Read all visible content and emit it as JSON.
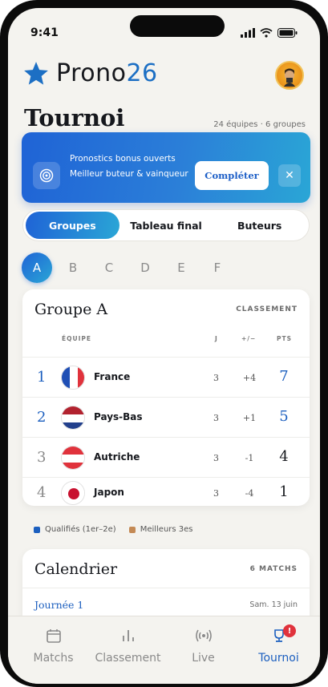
{
  "status": {
    "time": "9:41"
  },
  "brand": {
    "name_prefix": "Prono",
    "name_number": "26"
  },
  "page": {
    "title": "Tournoi",
    "meta": "24 équipes · 6 groupes"
  },
  "banner": {
    "line1": "Pronostics bonus ouverts",
    "line2": "Meilleur buteur & vainqueur",
    "cta": "Compléter",
    "close": "✕"
  },
  "segments": [
    {
      "label": "Groupes",
      "active": true
    },
    {
      "label": "Tableau final",
      "active": false
    },
    {
      "label": "Buteurs",
      "active": false
    }
  ],
  "group_letters": [
    "A",
    "B",
    "C",
    "D",
    "E",
    "F"
  ],
  "group_table": {
    "title": "Groupe A",
    "aux": "CLASSEMENT",
    "headers": {
      "team": "ÉQUIPE",
      "played": "J",
      "diff": "+/−",
      "points": "PTS"
    },
    "rows": [
      {
        "rank": "1",
        "team": "France",
        "played": "3",
        "diff": "+4",
        "points": "7"
      },
      {
        "rank": "2",
        "team": "Pays-Bas",
        "played": "3",
        "diff": "+1",
        "points": "5"
      },
      {
        "rank": "3",
        "team": "Autriche",
        "played": "3",
        "diff": "-1",
        "points": "4"
      },
      {
        "rank": "4",
        "team": "Japon",
        "played": "3",
        "diff": "-4",
        "points": "1"
      }
    ]
  },
  "legend": {
    "qualified": "Qualifiés (1er–2e)",
    "best_third": "Meilleurs 3es",
    "qualified_color": "#1c5fbf",
    "best_third_color": "#c48a55"
  },
  "calendar": {
    "title": "Calendrier",
    "aux": "6 MATCHS",
    "day": "Journée 1",
    "date": "Sam. 13 juin"
  },
  "tabbar": {
    "items": [
      {
        "label": "Matchs",
        "icon": "calendar-icon"
      },
      {
        "label": "Classement",
        "icon": "bar-chart-icon"
      },
      {
        "label": "Live",
        "icon": "broadcast-icon"
      },
      {
        "label": "Tournoi",
        "icon": "trophy-icon"
      }
    ],
    "badge": "!"
  },
  "colors": {
    "accent": "#1c5fbf",
    "accent_light": "#2aa6d6",
    "background": "#f4f3ef"
  }
}
